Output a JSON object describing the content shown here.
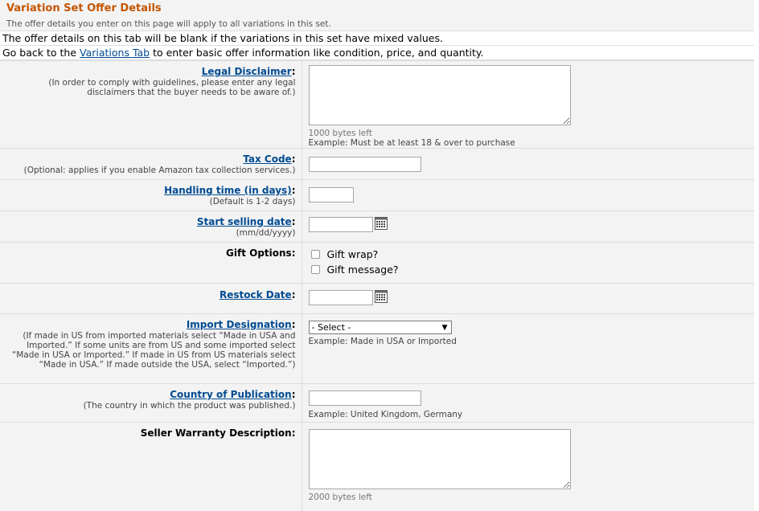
{
  "header": {
    "title": "Variation Set Offer Details",
    "subtitle": "The offer details you enter on this page will apply to all variations in this set."
  },
  "notes": {
    "line1": "The offer details on this tab will be blank if the variations in this set have mixed values.",
    "line2_pre": "Go back to the ",
    "line2_link": "Variations Tab",
    "line2_post": " to enter basic offer information like condition, price, and quantity."
  },
  "fields": {
    "legal": {
      "label": "Legal Disclaimer",
      "hint": "(In order to comply with guidelines, please enter any legal disclaimers that the buyer needs to be aware of.)",
      "bytes_left": "1000 bytes left",
      "example": "Example: Must be at least 18 & over to purchase",
      "value": ""
    },
    "tax": {
      "label": "Tax Code",
      "hint": "(Optional: applies if you enable Amazon tax collection services.)",
      "value": ""
    },
    "handling": {
      "label": "Handling time (in days)",
      "hint": "(Default is 1-2 days)",
      "value": ""
    },
    "start_date": {
      "label": "Start selling date",
      "hint": "(mm/dd/yyyy)",
      "value": ""
    },
    "gift": {
      "label": "Gift Options:",
      "wrap": "Gift wrap?",
      "message": "Gift message?"
    },
    "restock": {
      "label": "Restock Date",
      "value": ""
    },
    "import": {
      "label": "Import Designation",
      "hint": "(If made in US from imported materials select “Made in USA and Imported.” If some units are from US and some imported select “Made in USA or Imported.” If made in US from US materials select “Made in USA.” If made outside the USA, select “Imported.”)",
      "selected": "- Select -",
      "example": "Example: Made in USA or Imported"
    },
    "country": {
      "label": "Country of Publication",
      "hint": "(The country in which the product was published.)",
      "example": "Example: United Kingdom, Germany",
      "value": ""
    },
    "warranty": {
      "label": "Seller Warranty Description:",
      "bytes_left": "2000 bytes left",
      "value": ""
    }
  },
  "colon": ":",
  "colors": {
    "title": "#c45500",
    "link": "#004b91",
    "background": "#f3f3f3",
    "border": "#dcdcdc"
  }
}
